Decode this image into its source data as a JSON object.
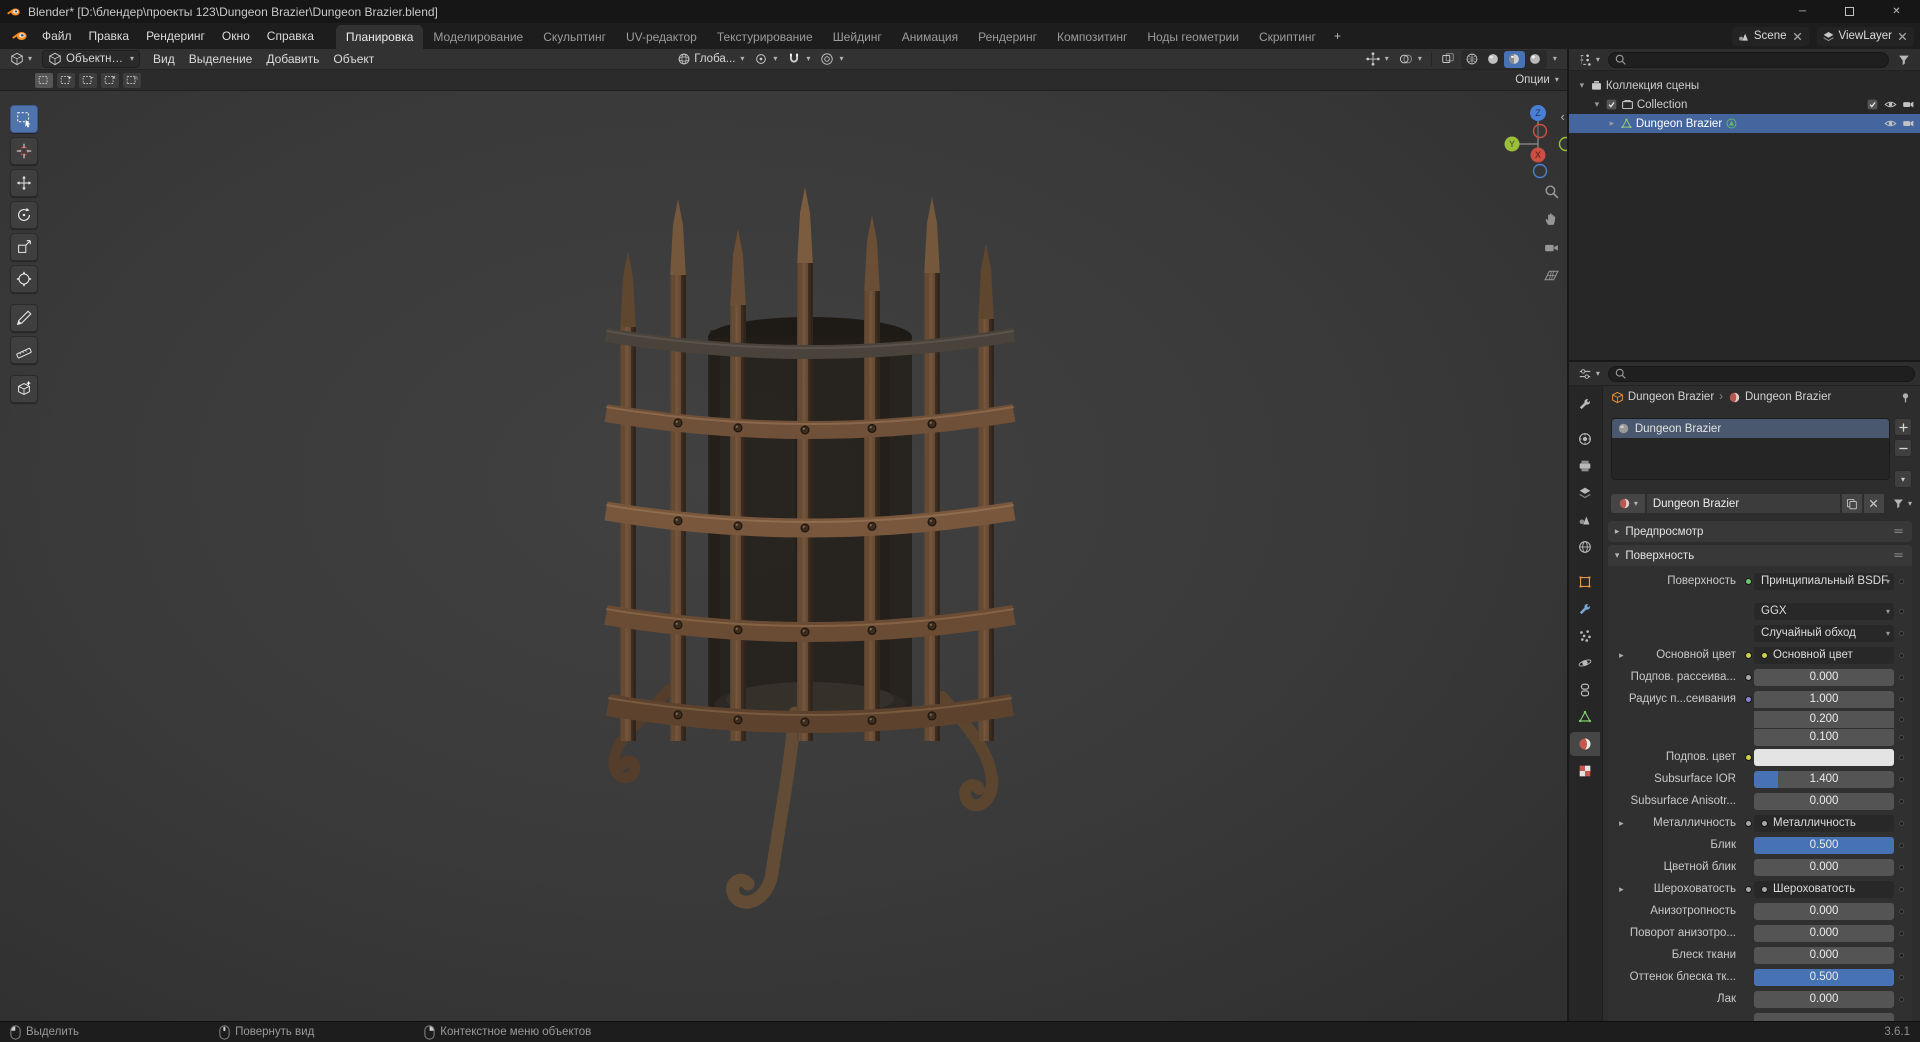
{
  "window": {
    "title": "Blender* [D:\\блендер\\проекты 123\\Dungeon Brazier\\Dungeon Brazier.blend]"
  },
  "topbar": {
    "menus": [
      "Файл",
      "Правка",
      "Рендеринг",
      "Окно",
      "Справка"
    ],
    "workspaces": [
      "Планировка",
      "Моделирование",
      "Скульптинг",
      "UV-редактор",
      "Текстурирование",
      "Шейдинг",
      "Анимация",
      "Рендеринг",
      "Композитинг",
      "Ноды геометрии",
      "Скриптинг"
    ],
    "active_workspace": "Планировка",
    "add_workspace": "+",
    "scene": {
      "label": "Scene"
    },
    "view_layer": {
      "label": "ViewLayer"
    }
  },
  "viewport": {
    "header": {
      "mode": "Объектный режим",
      "menus": [
        "Вид",
        "Выделение",
        "Добавить",
        "Объект"
      ],
      "orientation": "Глоба...",
      "options_label": "Опции"
    },
    "tools": [
      "select-box",
      "cursor",
      "move",
      "rotate",
      "scale",
      "transform",
      "annotate",
      "measure",
      "add-cube"
    ],
    "active_tool": "select-box",
    "select_modes": [
      "set",
      "extend",
      "subtract",
      "invert",
      "intersect"
    ]
  },
  "outliner": {
    "rows": [
      {
        "label": "Коллекция сцены",
        "icon": "scene-collection",
        "indent": 0,
        "disclosure": "open",
        "right_icons": []
      },
      {
        "label": "Collection",
        "icon": "collection",
        "indent": 1,
        "disclosure": "open",
        "checkbox": true,
        "right_icons": [
          "checkbox",
          "eye",
          "camera"
        ]
      },
      {
        "label": "Dungeon Brazier",
        "icon": "mesh-object",
        "indent": 2,
        "disclosure": "closed",
        "selected": true,
        "suffix_icon": "mesh-data",
        "right_icons": [
          "eye",
          "camera"
        ]
      }
    ]
  },
  "properties": {
    "breadcrumb": {
      "object": "Dungeon Brazier",
      "material": "Dungeon Brazier"
    },
    "tabs": [
      {
        "name": "tool"
      },
      {
        "name": "render"
      },
      {
        "name": "output"
      },
      {
        "name": "view-layer"
      },
      {
        "name": "scene"
      },
      {
        "name": "world"
      },
      {
        "name": "object"
      },
      {
        "name": "modifiers"
      },
      {
        "name": "particles"
      },
      {
        "name": "physics"
      },
      {
        "name": "constraints"
      },
      {
        "name": "object-data"
      },
      {
        "name": "material",
        "active": true
      },
      {
        "name": "texture"
      }
    ],
    "slots": {
      "items": [
        "Dungeon Brazier"
      ],
      "selected_index": 0
    },
    "datablock": {
      "name": "Dungeon Brazier"
    },
    "panels": [
      {
        "label": "Предпросмотр",
        "collapsed": true
      },
      {
        "label": "Поверхность",
        "collapsed": false
      }
    ],
    "surface_rows": [
      {
        "label": "Поверхность",
        "type": "dropdown",
        "value": "Принципиальный BSDF",
        "socket": "green"
      },
      {
        "label": "",
        "type": "dropdown",
        "value": "GGX"
      },
      {
        "label": "",
        "type": "dropdown",
        "value": "Случайный обход"
      },
      {
        "label": "Основной цвет",
        "type": "link",
        "value": "Основной цвет",
        "socket": "yellow",
        "expandable": true
      },
      {
        "label": "Подпов. рассеива...",
        "type": "value",
        "value": "0.000",
        "fill": 0,
        "socket": "gray"
      },
      {
        "label": "Радиус п...сеивания",
        "type": "vector",
        "values": [
          "1.000",
          "0.200",
          "0.100"
        ],
        "socket": "vector"
      },
      {
        "label": "Подпов. цвет",
        "type": "color",
        "swatch": "#e4e4e4",
        "socket": "yellow"
      },
      {
        "label": "Subsurface IOR",
        "type": "value",
        "value": "1.400",
        "fill": 0.17
      },
      {
        "label": "Subsurface Anisotr...",
        "type": "value",
        "value": "0.000",
        "fill": 0
      },
      {
        "label": "Металличность",
        "type": "link",
        "value": "Металличность",
        "socket": "gray",
        "expandable": true
      },
      {
        "label": "Блик",
        "type": "value",
        "value": "0.500",
        "fill": 1
      },
      {
        "label": "Цветной блик",
        "type": "value",
        "value": "0.000",
        "fill": 0
      },
      {
        "label": "Шероховатость",
        "type": "link",
        "value": "Шероховатость",
        "socket": "gray",
        "expandable": true
      },
      {
        "label": "Анизотропность",
        "type": "value",
        "value": "0.000",
        "fill": 0
      },
      {
        "label": "Поворот анизотро...",
        "type": "value",
        "value": "0.000",
        "fill": 0
      },
      {
        "label": "Блеск ткани",
        "type": "value",
        "value": "0.000",
        "fill": 0
      },
      {
        "label": "Оттенок блеска тк...",
        "type": "value",
        "value": "0.500",
        "fill": 1
      },
      {
        "label": "Лак",
        "type": "value",
        "value": "0.000",
        "fill": 0
      }
    ]
  },
  "status": {
    "items": [
      {
        "icon": "mouse-left",
        "label": "Выделить"
      },
      {
        "icon": "mouse-middle",
        "label": "Повернуть вид"
      },
      {
        "icon": "mouse-right",
        "label": "Контекстное меню объектов"
      }
    ],
    "version": "3.6.1"
  },
  "colors": {
    "accent": "#4772b3",
    "selection": "#44659e",
    "viewport_bg": "#3d3d3d"
  }
}
